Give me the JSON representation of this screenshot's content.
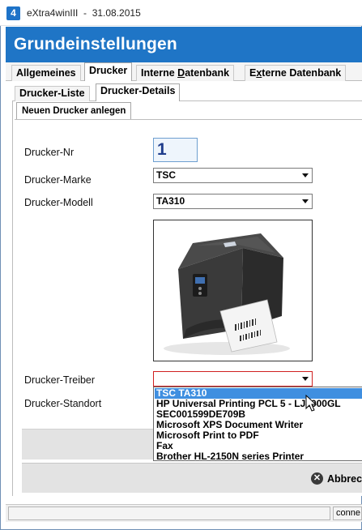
{
  "window": {
    "title": "eXtra4winIII  -  31.08.2015",
    "app_icon_glyph": "4"
  },
  "header": {
    "title": "Grundeinstellungen",
    "color": "#1f75c6"
  },
  "main_tabs": [
    {
      "label": "Allgemeines",
      "active": false
    },
    {
      "label": "Drucker",
      "active": true
    },
    {
      "label_pre": "Interne ",
      "label_ul": "D",
      "label_post": "atenbank",
      "active": false
    },
    {
      "label_pre": "E",
      "label_ul": "x",
      "label_post": "terne Datenbank",
      "active": false
    }
  ],
  "sub_tabs": [
    {
      "label": "Drucker-Liste",
      "active": false
    },
    {
      "label": "Drucker-Details",
      "active": true
    }
  ],
  "form": {
    "tab_label": "Neuen Drucker anlegen",
    "nr_label": "Drucker-Nr",
    "nr_value": "1",
    "marke_label": "Drucker-Marke",
    "marke_value": "TSC",
    "modell_label": "Drucker-Modell",
    "modell_value": "TA310",
    "treiber_label": "Drucker-Treiber",
    "treiber_value": "",
    "standort_label": "Drucker-Standort"
  },
  "driver_dropdown": {
    "options": [
      "TSC TA310",
      "HP Universal Printing PCL 5 - LJ4000GL",
      "SEC001599DE709B",
      "Microsoft XPS Document Writer",
      "Microsoft Print to PDF",
      "Fax",
      "Brother HL-2150N series Printer"
    ],
    "selected_index": 0,
    "highlight_color": "#3f8fe0"
  },
  "buttons": {
    "cancel_label": "Abbrech",
    "cancel_icon": "close-circle-icon"
  },
  "statusbar": {
    "left_text": "",
    "right_text": "conne"
  }
}
